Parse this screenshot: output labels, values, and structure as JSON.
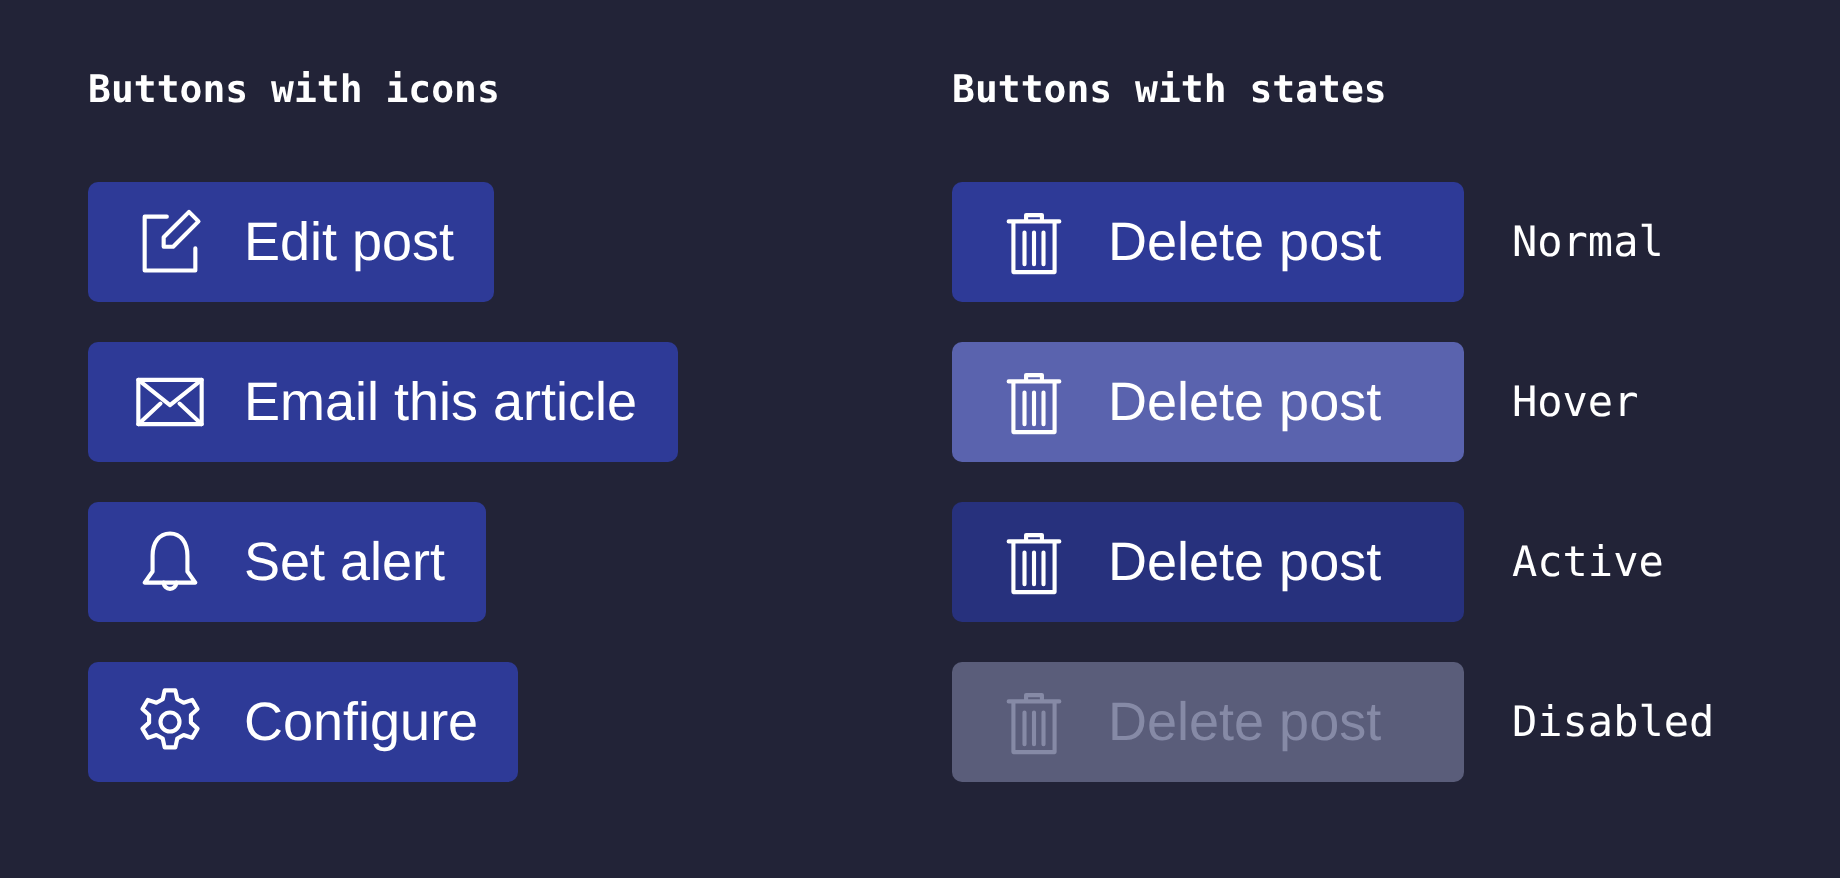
{
  "icon_buttons": {
    "heading": "Buttons with icons",
    "buttons": [
      {
        "label": "Edit post",
        "kind": "edit"
      },
      {
        "label": "Email this article",
        "kind": "mail"
      },
      {
        "label": "Set alert",
        "kind": "bell"
      },
      {
        "label": "Configure",
        "kind": "gear"
      }
    ]
  },
  "state_buttons": {
    "heading": "Buttons with states",
    "buttons": [
      {
        "label": "Delete post",
        "kind": "default",
        "state_label": "Normal"
      },
      {
        "label": "Delete post",
        "kind": "lighter",
        "state_label": "Hover"
      },
      {
        "label": "Delete post",
        "kind": "darker",
        "state_label": "Active"
      },
      {
        "label": "Delete post",
        "kind": "muted",
        "state_label": "Disabled"
      }
    ]
  }
}
